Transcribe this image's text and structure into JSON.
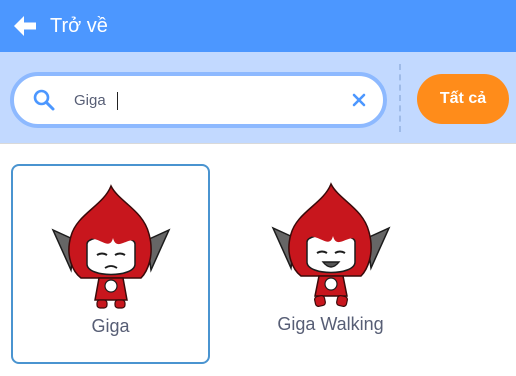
{
  "header": {
    "back_label": "Trở về",
    "background": "#4c97ff",
    "back_icon": "arrow-left-icon"
  },
  "search": {
    "value": "Giga",
    "search_icon": "search-icon",
    "clear_icon": "close-icon"
  },
  "filter": {
    "tag_label": "Tất cả",
    "tag_color": "#ff8c1a"
  },
  "sprites": [
    {
      "name": "Giga",
      "selected": true,
      "icon": "giga-sprite-icon"
    },
    {
      "name": "Giga Walking",
      "selected": false,
      "icon": "giga-walking-sprite-icon"
    }
  ]
}
